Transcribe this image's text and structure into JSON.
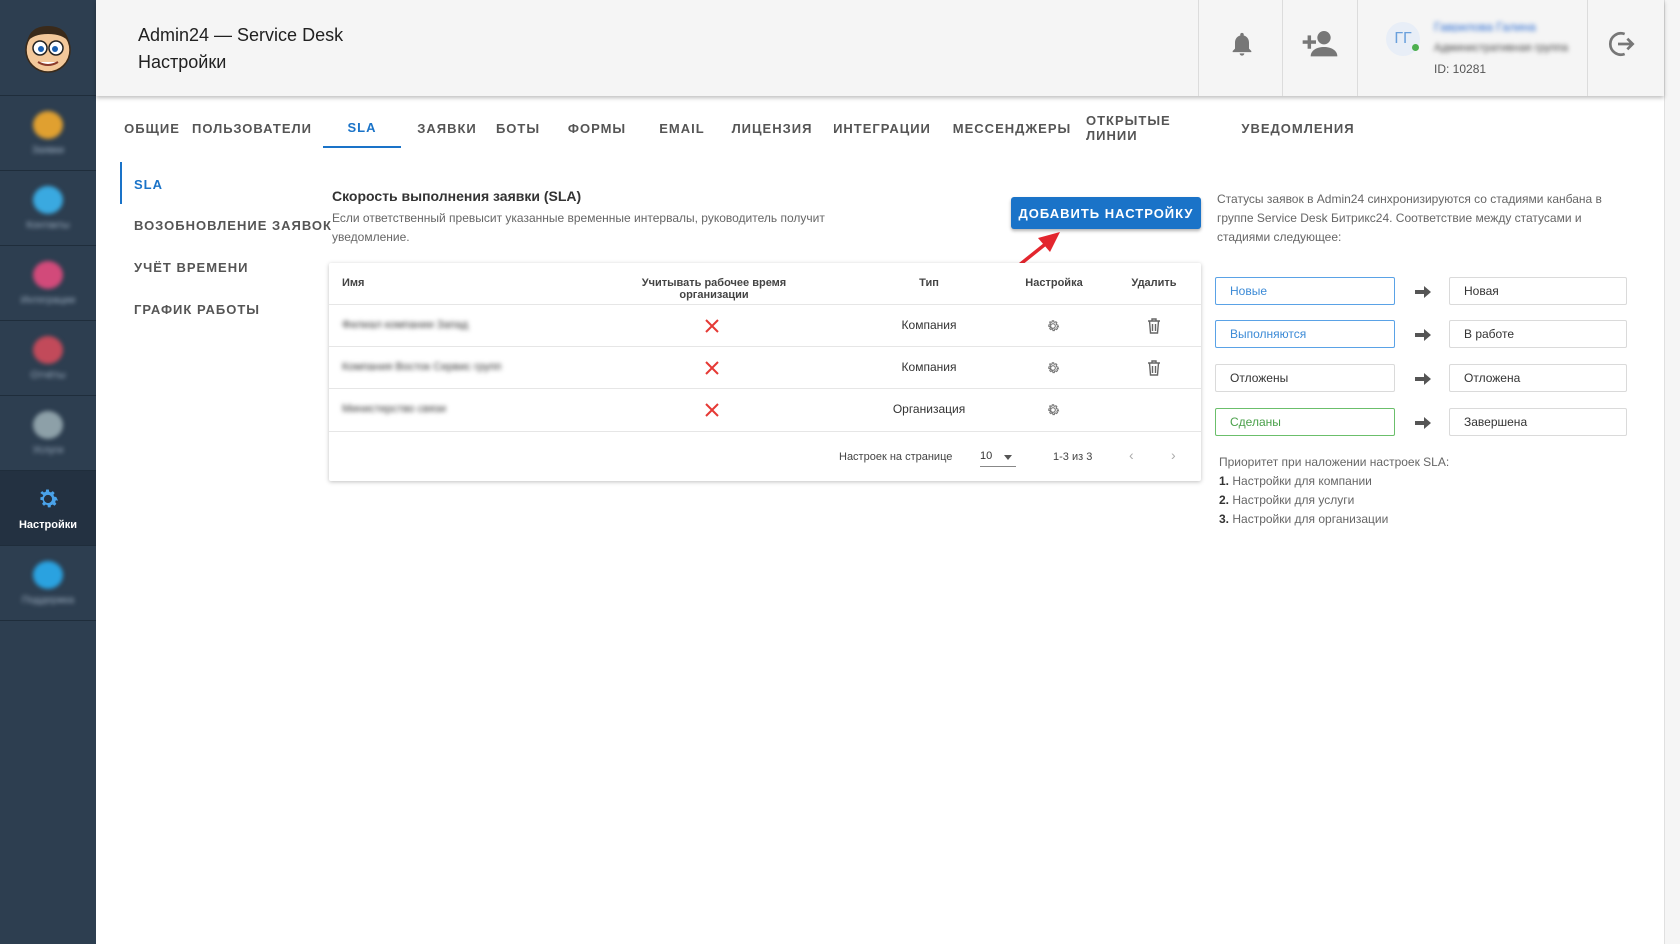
{
  "header": {
    "app_title": "Admin24 — Service Desk",
    "page_title": "Настройки",
    "user": {
      "initials": "ГГ",
      "name": "Гаврилова Галина",
      "subtitle": "Административная группа",
      "id_label": "ID: 10281"
    }
  },
  "sidebar": {
    "items": [
      {
        "label": "Заявки",
        "icon": "tickets-icon",
        "color": "#e0a030"
      },
      {
        "label": "Контакты",
        "icon": "contacts-icon",
        "color": "#3aa9e0"
      },
      {
        "label": "Интеграции",
        "icon": "integrations-icon",
        "color": "#d24a7a"
      },
      {
        "label": "Отчёты",
        "icon": "reports-icon",
        "color": "#c24a5a"
      },
      {
        "label": "Услуги",
        "icon": "services-icon",
        "color": "#8da0a8"
      },
      {
        "label": "Настройки",
        "icon": "gear-icon",
        "color": "#2b8fe0"
      },
      {
        "label": "Поддержка",
        "icon": "support-icon",
        "color": "#2aa2e0"
      }
    ]
  },
  "tabs": [
    {
      "label": "Общие"
    },
    {
      "label": "Пользователи"
    },
    {
      "label": "SLA"
    },
    {
      "label": "Заявки"
    },
    {
      "label": "Боты"
    },
    {
      "label": "Формы"
    },
    {
      "label": "Email"
    },
    {
      "label": "Лицензия"
    },
    {
      "label": "Интеграции"
    },
    {
      "label": "Мессенджеры"
    },
    {
      "label": "Открытые линии"
    },
    {
      "label": "Уведомления"
    }
  ],
  "subnav": [
    {
      "label": "SLA"
    },
    {
      "label": "Возобновление заявок"
    },
    {
      "label": "Учёт времени"
    },
    {
      "label": "График работы"
    }
  ],
  "section": {
    "title": "Скорость выполнения заявки (SLA)",
    "description": "Если ответственный превысит указанные временные интервалы, руководитель получит уведомление.",
    "add_button": "ДОБАВИТЬ НАСТРОЙКУ"
  },
  "table": {
    "columns": [
      "Имя",
      "Учитывать рабочее время организации",
      "Тип",
      "Настройка",
      "Удалить"
    ],
    "rows": [
      {
        "name": "Филиал компании Запад",
        "work_time": false,
        "type": "Компания",
        "deletable": true
      },
      {
        "name": "Компания Восток Сервис групп",
        "work_time": false,
        "type": "Компания",
        "deletable": true
      },
      {
        "name": "Министерство связи",
        "work_time": false,
        "type": "Организация",
        "deletable": false
      }
    ],
    "footer": {
      "per_page_label": "Настроек на странице",
      "per_page_value": "10",
      "range": "1-3 из 3"
    }
  },
  "mapping": {
    "description": "Статусы заявок в Admin24 синхронизируются со стадиями канбана в группе Service Desk Битрикс24. Соответствие между статусами и стадиями следующее:",
    "pairs": [
      {
        "status": "Новые",
        "stage": "Новая",
        "color": "#3b8ad6"
      },
      {
        "status": "Выполняются",
        "stage": "В работе",
        "color": "#3b8ad6"
      },
      {
        "status": "Отложены",
        "stage": "Отложена",
        "color": "#333333"
      },
      {
        "status": "Сделаны",
        "stage": "Завершена",
        "color": "#4aa04a"
      }
    ],
    "priority_title": "Приоритет при наложении настроек SLA:",
    "priority_items": [
      {
        "num": "1.",
        "text": "Настройки для компании"
      },
      {
        "num": "2.",
        "text": "Настройки для услуги"
      },
      {
        "num": "3.",
        "text": "Настройки для организации"
      }
    ]
  },
  "colors": {
    "accent": "#1a73c8",
    "sidebar": "#2d3e50",
    "danger": "#e53935"
  }
}
